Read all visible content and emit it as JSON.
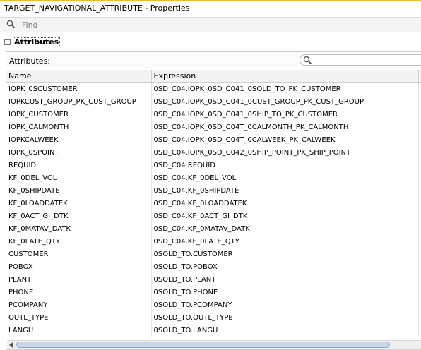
{
  "window": {
    "title": "TARGET_NAVIGATIONAL_ATTRIBUTE - Properties"
  },
  "find": {
    "placeholder": "Find",
    "icon": "search-icon"
  },
  "section": {
    "title": "Attributes"
  },
  "panel": {
    "label": "Attributes:",
    "search_icon": "search-icon"
  },
  "table": {
    "headers": [
      "Name",
      "Expression"
    ],
    "rows": [
      [
        "IOPK_0SCUSTOMER",
        "0SD_C04.IOPK_0SD_C041_0SOLD_TO_PK_CUSTOMER"
      ],
      [
        "IOPKCUST_GROUP_PK_CUST_GROUP",
        "0SD_C04.IOPK_0SD_C041_0CUST_GROUP_PK_CUST_GROUP"
      ],
      [
        "IOPK_CUSTOMER",
        "0SD_C04.IOPK_0SD_C041_0SHIP_TO_PK_CUSTOMER"
      ],
      [
        "IOPK_CALMONTH",
        "0SD_C04.IOPK_0SD_C04T_0CALMONTH_PK_CALMONTH"
      ],
      [
        "IOPKCALWEEK",
        "0SD_C04.IOPK_0SD_C04T_0CALWEEK_PK_CALWEEK"
      ],
      [
        "IOPK_0SPOINT",
        "0SD_C04.IOPK_0SD_C042_0SHIP_POINT_PK_SHIP_POINT"
      ],
      [
        "REQUID",
        "0SD_C04.REQUID"
      ],
      [
        "KF_0DEL_VOL",
        "0SD_C04.KF_0DEL_VOL"
      ],
      [
        "KF_0SHIPDATE",
        "0SD_C04.KF_0SHIPDATE"
      ],
      [
        "KF_0LOADDATEK",
        "0SD_C04.KF_0LOADDATEK"
      ],
      [
        "KF_0ACT_GI_DTK",
        "0SD_C04.KF_0ACT_GI_DTK"
      ],
      [
        "KF_0MATAV_DATK",
        "0SD_C04.KF_0MATAV_DATK"
      ],
      [
        "KF_0LATE_QTY",
        "0SD_C04.KF_0LATE_QTY"
      ],
      [
        "CUSTOMER",
        "0SOLD_TO.CUSTOMER"
      ],
      [
        "POBOX",
        "0SOLD_TO.POBOX"
      ],
      [
        "PLANT",
        "0SOLD_TO.PLANT"
      ],
      [
        "PHONE",
        "0SOLD_TO.PHONE"
      ],
      [
        "PCOMPANY",
        "0SOLD_TO.PCOMPANY"
      ],
      [
        "OUTL_TYPE",
        "0SOLD_TO.OUTL_TYPE"
      ],
      [
        "LANGU",
        "0SOLD_TO.LANGU"
      ]
    ]
  },
  "colors": {
    "accent": "#f5b632",
    "scroll_thumb": "#c9d6e8"
  }
}
